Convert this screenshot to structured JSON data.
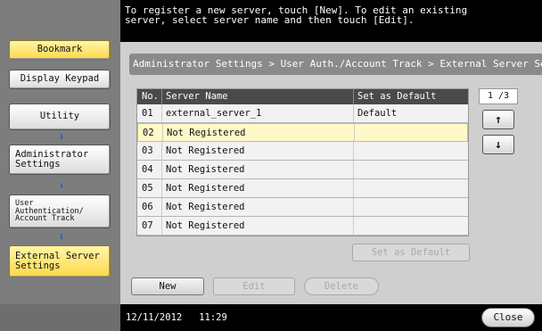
{
  "message": {
    "line1": "To register a new server, touch [New]. To edit an existing",
    "line2": "server, select server name and then touch [Edit]."
  },
  "left_panel": {
    "bookmark": "Bookmark",
    "display_keypad": "Display Keypad",
    "nav": [
      {
        "label": "Utility"
      },
      {
        "label": "Administrator\nSettings"
      },
      {
        "label": "User\nAuthentication/\nAccount Track"
      },
      {
        "label": "External Server\nSettings"
      }
    ]
  },
  "breadcrumb": "Administrator Settings > User Auth./Account Track > External Server Settings",
  "table": {
    "headers": {
      "no": "No.",
      "name": "Server Name",
      "default": "Set as Default"
    },
    "rows": [
      {
        "no": "01",
        "name": "external_server_1",
        "default": "Default"
      },
      {
        "no": "02",
        "name": "Not Registered",
        "default": ""
      },
      {
        "no": "03",
        "name": "Not Registered",
        "default": ""
      },
      {
        "no": "04",
        "name": "Not Registered",
        "default": ""
      },
      {
        "no": "05",
        "name": "Not Registered",
        "default": ""
      },
      {
        "no": "06",
        "name": "Not Registered",
        "default": ""
      },
      {
        "no": "07",
        "name": "Not Registered",
        "default": ""
      }
    ],
    "selected_row": "02"
  },
  "pager": {
    "indicator": "1 /3",
    "up": "↑",
    "down": "↓"
  },
  "buttons": {
    "set_default": "Set as Default",
    "new": "New",
    "edit": "Edit",
    "delete": "Delete",
    "close": "Close"
  },
  "status": {
    "date": "12/11/2012",
    "time": "11:29"
  },
  "colors": {
    "selected_row": "#fff8c8",
    "highlight_nav": "#ffd84a",
    "arrow": "#1f5fd6"
  }
}
